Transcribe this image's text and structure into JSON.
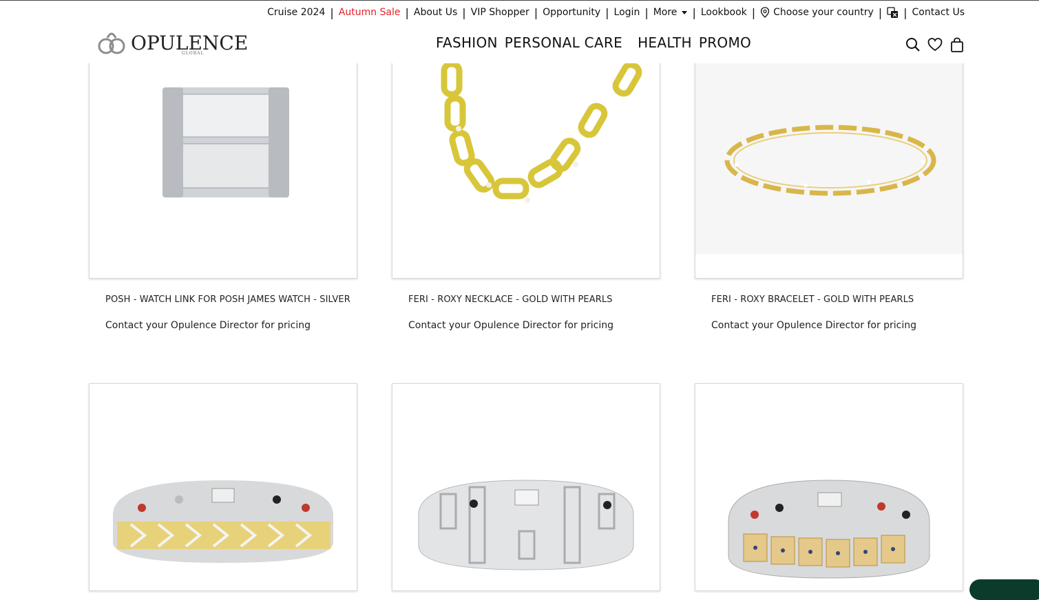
{
  "topbar": {
    "items": [
      "Cruise 2024",
      "Autumn Sale",
      "About Us",
      "VIP Shopper",
      "Opportunity",
      "Login",
      "More",
      "Lookbook",
      "Choose your country",
      "Contact Us"
    ]
  },
  "brand": {
    "name": "OPULENCE",
    "sub": "GLOBAL"
  },
  "nav": {
    "items": [
      "FASHION",
      "PERSONAL CARE",
      "HEALTH",
      "PROMO"
    ]
  },
  "icons": [
    "search-icon",
    "heart-icon",
    "bag-icon",
    "location-icon",
    "translate-icon"
  ],
  "colors": {
    "sale": "#e32229",
    "chat": "#0b3b2a"
  },
  "products": [
    {
      "title": "POSH - WATCH LINK FOR POSH JAMES WATCH - SILVER",
      "price": "Contact your Opulence Director for pricing"
    },
    {
      "title": "FERI - ROXY NECKLACE - GOLD WITH PEARLS",
      "price": "Contact your Opulence Director for pricing"
    },
    {
      "title": "FERI - ROXY BRACELET - GOLD WITH PEARLS",
      "price": "Contact your Opulence Director for pricing"
    }
  ]
}
